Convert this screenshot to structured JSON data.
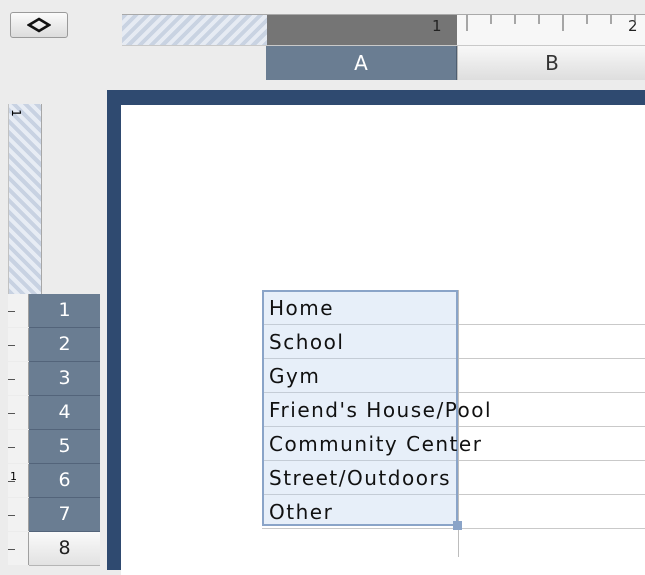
{
  "toolbar": {
    "toggle_icon": "diamond-icon"
  },
  "ruler": {
    "top_marks": [
      "1",
      "2"
    ],
    "left_marks": [
      "1",
      "1"
    ]
  },
  "columns": [
    "A",
    "B"
  ],
  "rows": [
    "1",
    "2",
    "3",
    "4",
    "5",
    "6",
    "7",
    "8"
  ],
  "cells": [
    "Home",
    "School",
    "Gym",
    "Friend's House/Pool",
    "Community Center",
    "Street/Outdoors",
    "Other"
  ],
  "colors": {
    "header_selected": "#6a7d92",
    "page_border": "#2f4a70",
    "selection": "#8aa4c8"
  }
}
